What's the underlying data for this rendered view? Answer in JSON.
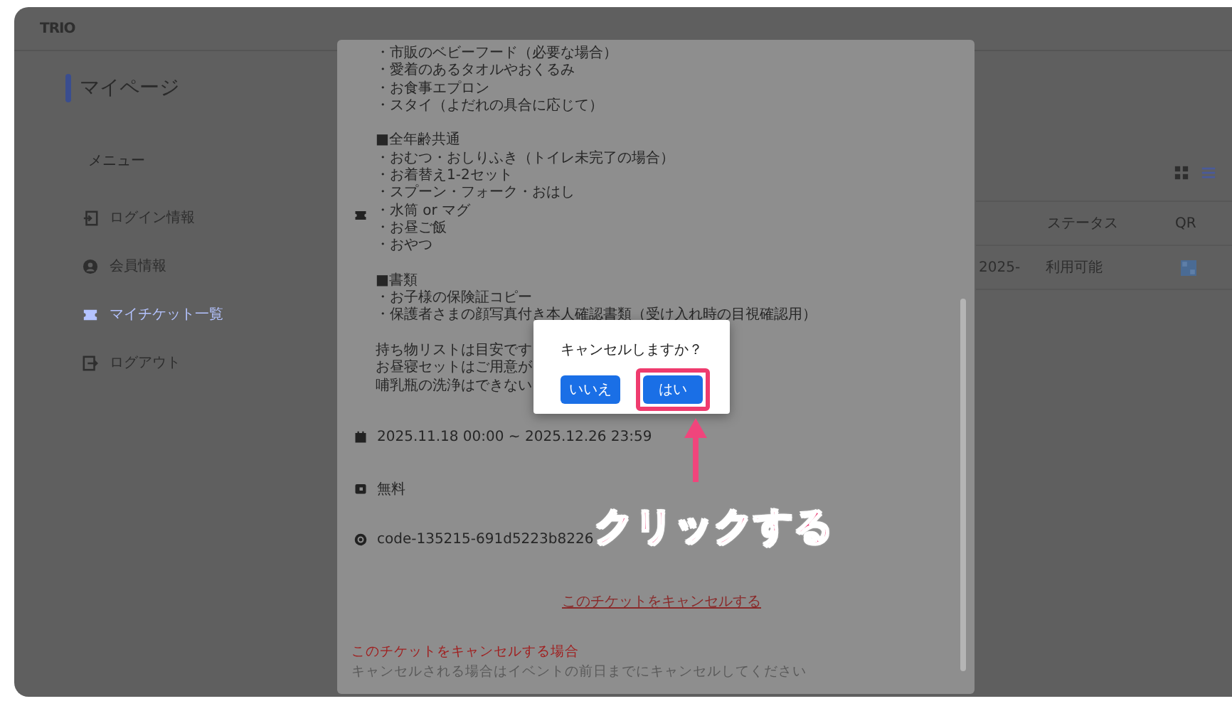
{
  "header": {
    "logo": "TRIO"
  },
  "sidebar": {
    "title": "マイページ",
    "section": "メニュー",
    "items": [
      {
        "label": "ログイン情報",
        "selected": false
      },
      {
        "label": "会員情報",
        "selected": false
      },
      {
        "label": "マイチケット一覧",
        "selected": true
      },
      {
        "label": "ログアウト",
        "selected": false
      }
    ]
  },
  "view_toggle": [
    {
      "selected": false
    },
    {
      "selected": true
    }
  ],
  "table": {
    "columns": [
      "ステータス",
      "QR"
    ],
    "rows": [
      {
        "date": "2025-",
        "status": "利用可能"
      }
    ]
  },
  "modal": {
    "sections": [
      {
        "lines": [
          "・市販のベビーフード（必要な場合）",
          "・愛着のあるタオルやおくるみ",
          "・お食事エプロン",
          "・スタイ（よだれの具合に応じて）"
        ]
      },
      {
        "lines": [
          "■全年齢共通",
          "・おむつ・おしりふき（トイレ未完了の場合）",
          "・お着替え1-2セット",
          "・スプーン・フォーク・おはし",
          "・水筒 or マグ",
          "・お昼ご飯",
          "・おやつ"
        ]
      },
      {
        "lines": [
          "■書類",
          "・お子様の保険証コピー",
          "・保護者さまの顔写真付き本人確認書類（受け入れ時の目視確認用）"
        ]
      },
      {
        "lines": [
          "持ち物リストは目安です",
          "お昼寝セットはご用意が",
          "哺乳瓶の洗浄はできない"
        ]
      }
    ],
    "period": "2025.11.18 00:00 ~ 2025.12.26 23:59",
    "price": "無料",
    "code": "code-135215-691d5223b8226",
    "cancel_link": "このチケットをキャンセルする",
    "note_title": "このチケットをキャンセルする場合",
    "note_text": "キャンセルされる場合はイベントの前日までにキャンセルしてください"
  },
  "dialog": {
    "question": "キャンセルしますか？",
    "buttons": [
      {
        "label": "いいえ",
        "highlighted": false
      },
      {
        "label": "はい",
        "highlighted": true
      }
    ]
  },
  "annotation": {
    "label": "クリックする"
  }
}
